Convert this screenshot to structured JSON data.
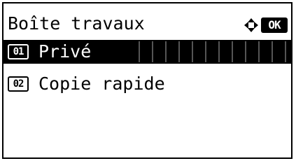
{
  "screen": {
    "title": "Boîte travaux",
    "nav_icon": "four-way-arrow-icon",
    "ok_label": "OK"
  },
  "menu": {
    "items": [
      {
        "number": "01",
        "label": "Privé",
        "selected": true
      },
      {
        "number": "02",
        "label": "Copie rapide",
        "selected": false
      }
    ]
  },
  "colors": {
    "foreground": "#000000",
    "background": "#ffffff"
  }
}
